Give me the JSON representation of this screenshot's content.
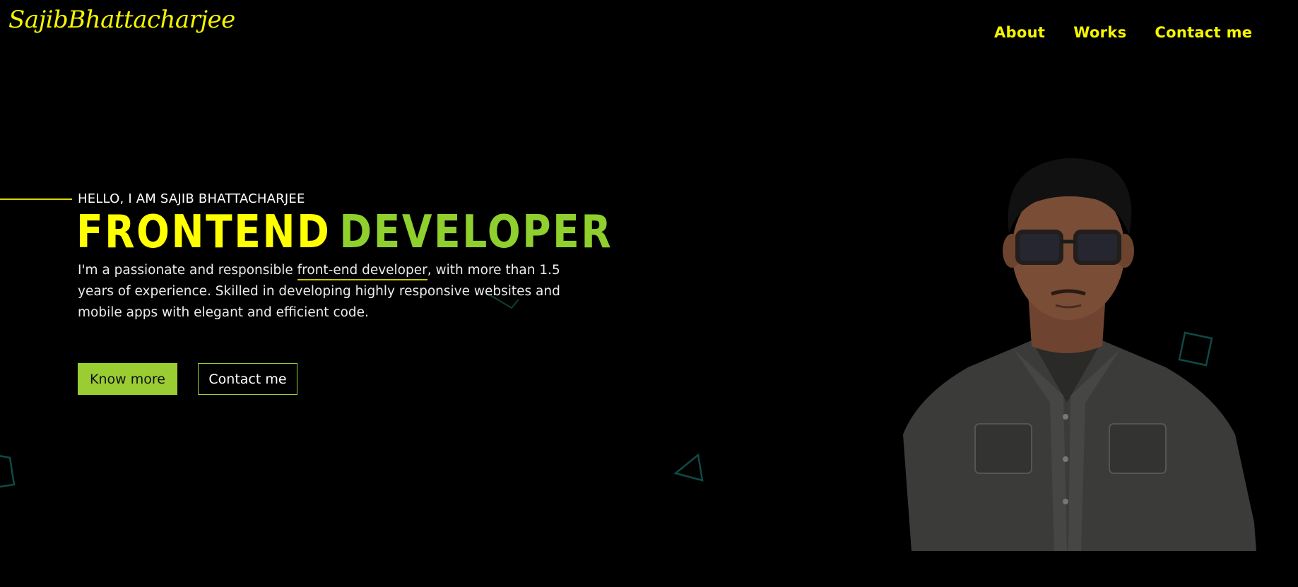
{
  "logo": {
    "text": "SajibBhattacharjee"
  },
  "nav": {
    "items": [
      "About",
      "Works",
      "Contact me"
    ]
  },
  "hero": {
    "eyebrow": "HELLO, I AM SAJIB BHATTACHARJEE",
    "title_word1": "FRONTEND",
    "title_word2": "DEVELOPER",
    "desc_before": "I'm a passionate and responsible ",
    "desc_highlight": "front-end developer",
    "desc_after": ", with more than 1.5 years of experience. Skilled in developing highly responsive websites and mobile apps with elegant and efficient code.",
    "primary_button": "Know more",
    "secondary_button": "Contact me"
  },
  "colors": {
    "background": "#000000",
    "accent_yellow": "#ffff00",
    "accent_green": "#9acd32",
    "decoration_teal": "#0e4a46"
  },
  "icons": [
    "triangle-outline-icon",
    "square-outline-icon"
  ]
}
